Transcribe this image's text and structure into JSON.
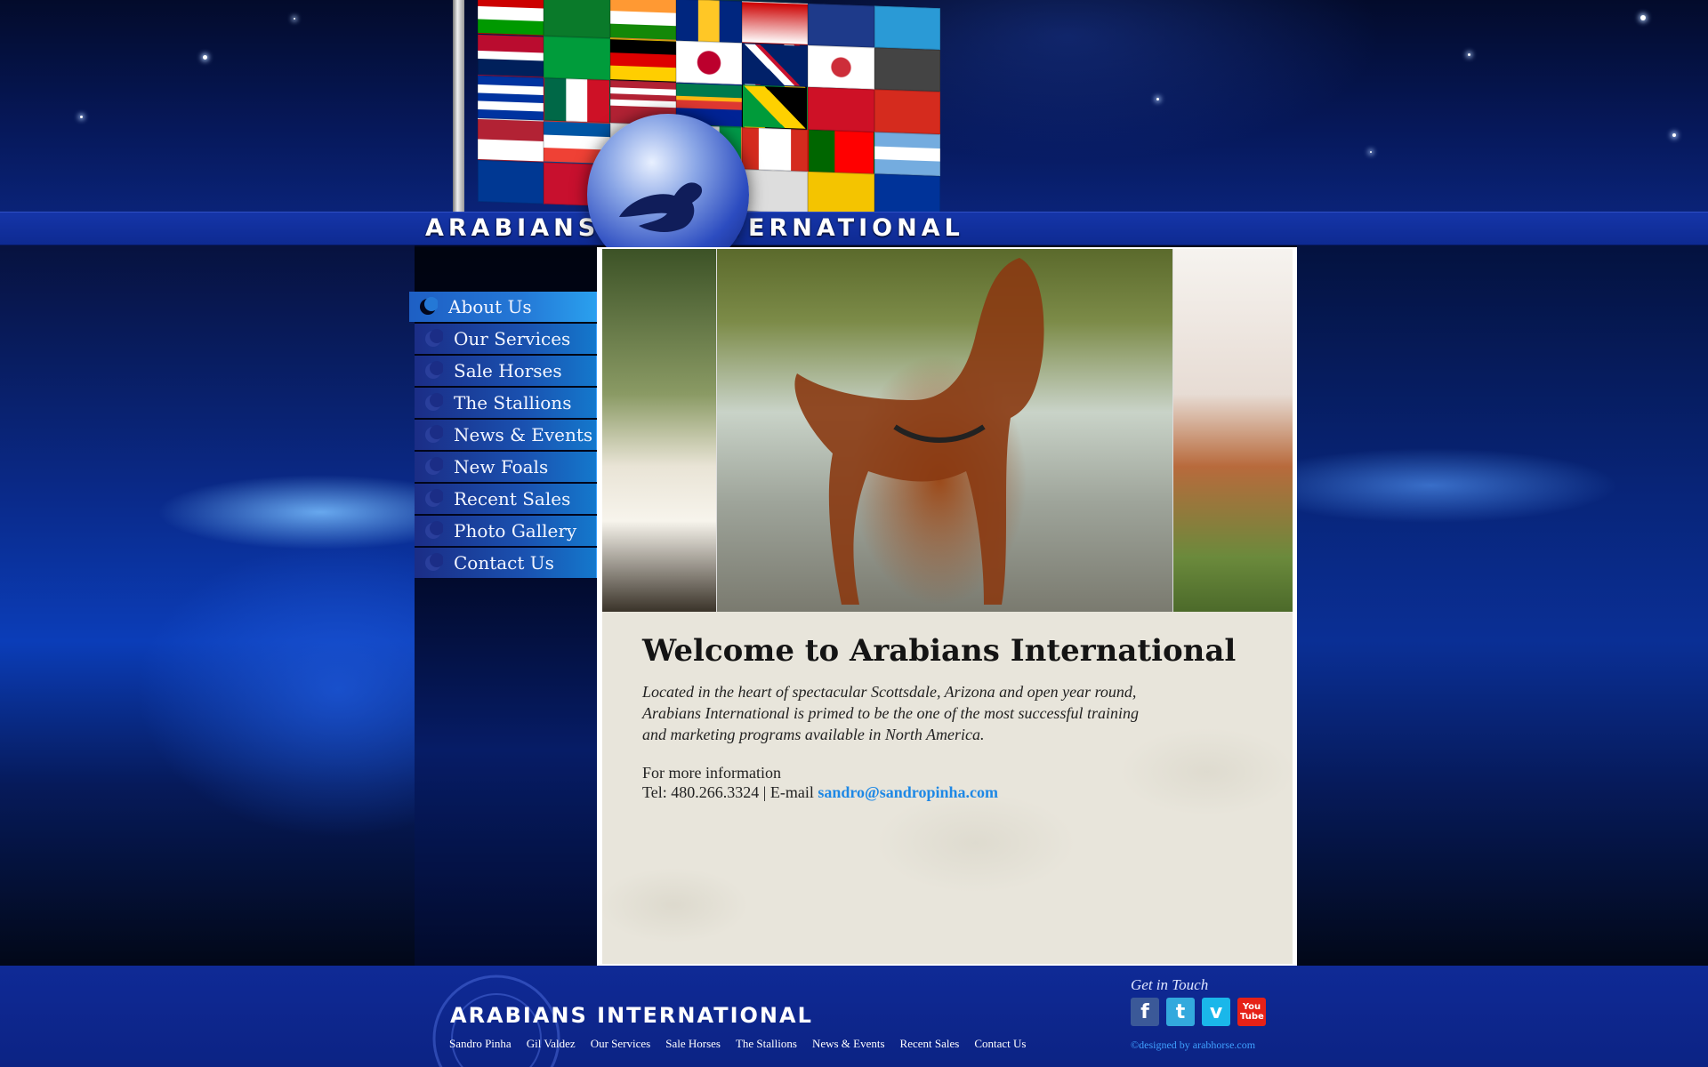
{
  "brand": {
    "word1": "ARABIANS",
    "word2": "INTERNATIONAL"
  },
  "nav": {
    "items": [
      {
        "label": "About Us",
        "active": true
      },
      {
        "label": "Our Services"
      },
      {
        "label": "Sale Horses"
      },
      {
        "label": "The Stallions"
      },
      {
        "label": "News & Events"
      },
      {
        "label": "New Foals"
      },
      {
        "label": "Recent Sales"
      },
      {
        "label": "Photo Gallery"
      },
      {
        "label": "Contact Us"
      }
    ]
  },
  "main": {
    "title": "Welcome to Arabians International",
    "body": "Located in the heart of spectacular Scottsdale, Arizona and open year round, Arabians International is primed to be the one of the most successful training and marketing programs available in North America.",
    "info_label": "For more information",
    "tel": "Tel: 480.266.3324 | E-mail ",
    "email": "sandro@sandropinha.com"
  },
  "footer": {
    "logo": "ARABIANS INTERNATIONAL",
    "links": [
      "Sandro Pinha",
      "Gil Valdez",
      "Our Services",
      "Sale Horses",
      "The Stallions",
      "News & Events",
      "Recent Sales",
      "Contact Us"
    ],
    "get_in_touch": "Get in Touch",
    "social": [
      {
        "icon": "facebook-icon",
        "glyph": "f",
        "color": "#3b5998"
      },
      {
        "icon": "twitter-icon",
        "glyph": "t",
        "color": "#33a9dd"
      },
      {
        "icon": "vimeo-icon",
        "glyph": "v",
        "color": "#1ab7ea"
      },
      {
        "icon": "youtube-icon",
        "glyph": "You Tube",
        "color": "#e62117"
      }
    ],
    "credit": "©designed by arabhorse.com"
  },
  "colors": {
    "header_band": "#0e2a92",
    "nav_gradient_end": "#1478cc",
    "panel_bg": "#e8e5db",
    "link": "#1e88e5",
    "footer": "#0c2384"
  }
}
